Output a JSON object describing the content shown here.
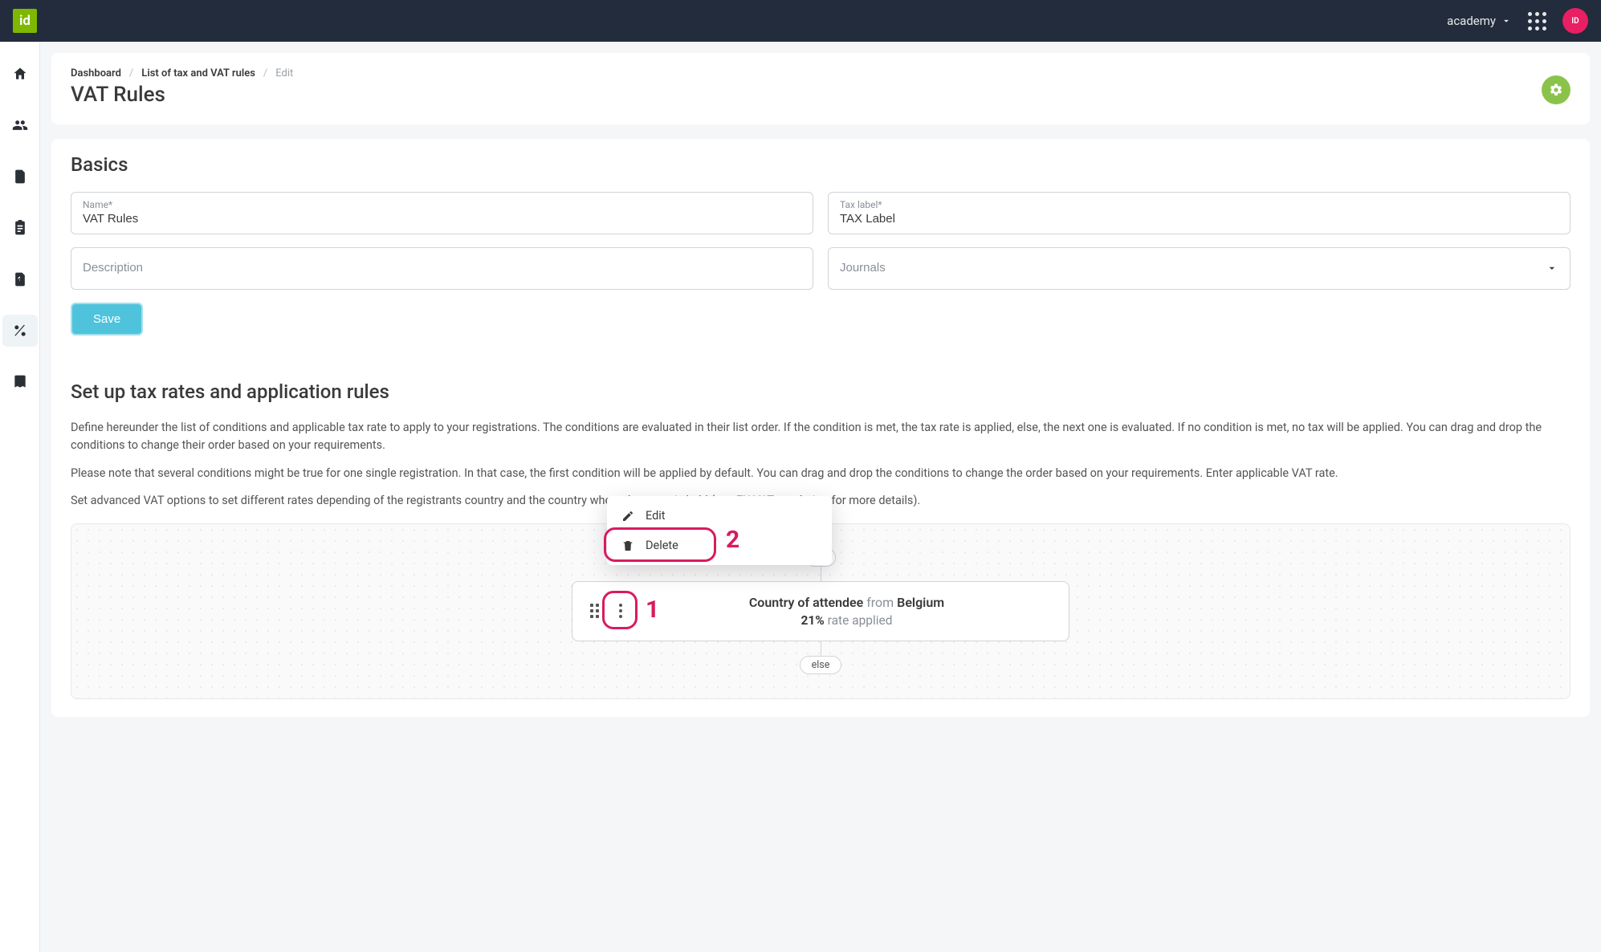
{
  "topbar": {
    "logo_text": "id",
    "account_name": "academy",
    "avatar_text": "ID"
  },
  "sidenav": {
    "items": [
      {
        "name": "home-icon"
      },
      {
        "name": "people-icon"
      },
      {
        "name": "form-icon"
      },
      {
        "name": "clipboard-icon"
      },
      {
        "name": "invoice-icon"
      },
      {
        "name": "percent-icon"
      },
      {
        "name": "book-icon"
      }
    ],
    "active_index": 5
  },
  "breadcrumb": {
    "items": [
      "Dashboard",
      "List of tax and VAT rules",
      "Edit"
    ]
  },
  "page_title": "VAT Rules",
  "basics": {
    "heading": "Basics",
    "name_label": "Name*",
    "name_value": "VAT Rules",
    "taxlabel_label": "Tax label*",
    "taxlabel_value": "TAX Label",
    "description_placeholder": "Description",
    "journals_placeholder": "Journals",
    "save_label": "Save"
  },
  "rules": {
    "heading": "Set up tax rates and application rules",
    "p1": "Define hereunder the list of conditions and applicable tax rate to apply to your registrations. The conditions are evaluated in their list order. If the condition is met, the tax rate is applied, else, the next one is evaluated. If no condition is met, no tax will be applied. You can drag and drop the conditions to change their order based on your requirements.",
    "p2": "Please note that several conditions might be true for one single registration. In that case, the first condition will be applied by default. You can drag and drop the conditions to change the order based on your requirements. Enter applicable VAT rate.",
    "p3": "Set advanced VAT options to set different rates depending of the registrants country and the country where the event is held (see EU VAT regulation for more details).",
    "flow": {
      "if_label": "if",
      "else_label": "else"
    },
    "card": {
      "condition_field": "Country of attendee",
      "condition_word": "from",
      "condition_value": "Belgium",
      "rate_value": "21%",
      "rate_suffix": "rate applied"
    }
  },
  "popover": {
    "edit_label": "Edit",
    "delete_label": "Delete"
  },
  "annotations": {
    "num1": "1",
    "num2": "2"
  }
}
